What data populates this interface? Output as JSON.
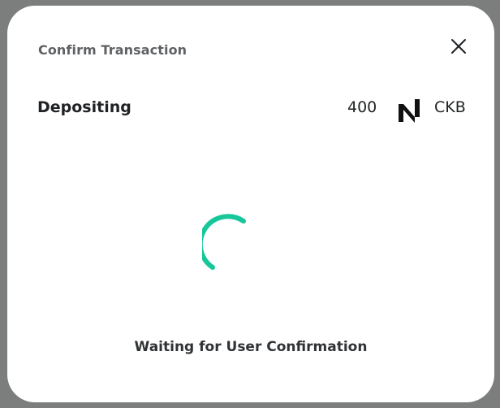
{
  "modal": {
    "title": "Confirm Transaction",
    "close_icon": "close-icon"
  },
  "transaction": {
    "label": "Depositing",
    "amount": "400",
    "token_icon": "nervos-ckb-logo-icon",
    "token_symbol": "CKB"
  },
  "loading": {
    "spinner_color": "#17c79a",
    "status": "Waiting for User Confirmation"
  },
  "colors": {
    "overlay": "#7b7d7d",
    "modal_background": "#ffffff",
    "title_text": "#5f6264",
    "body_text": "#1f2224"
  }
}
